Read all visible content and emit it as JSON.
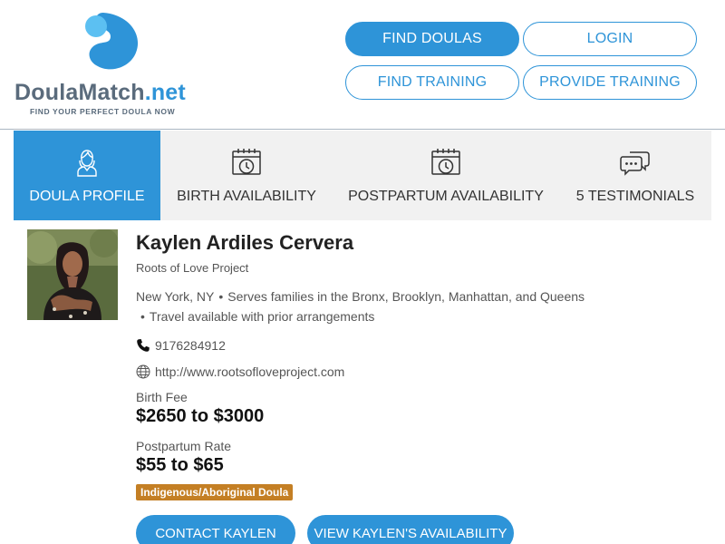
{
  "brand": {
    "name_main": "DoulaMatch",
    "name_suffix": ".net",
    "tagline": "FIND YOUR PERFECT DOULA NOW",
    "accent_color": "#2e94d8",
    "logo_icon": "droplet-logo-icon"
  },
  "nav": {
    "find_doulas": "FIND DOULAS",
    "login": "LOGIN",
    "find_training": "FIND TRAINING",
    "provide_training": "PROVIDE TRAINING"
  },
  "tabs": [
    {
      "label": "DOULA PROFILE",
      "icon": "person-icon",
      "active": true
    },
    {
      "label": "BIRTH AVAILABILITY",
      "icon": "calendar-clock-icon",
      "active": false
    },
    {
      "label": "POSTPARTUM AVAILABILITY",
      "icon": "calendar-clock-icon",
      "active": false
    },
    {
      "label": "5 TESTIMONIALS",
      "icon": "chat-bubbles-icon",
      "active": false
    }
  ],
  "profile": {
    "name": "Kaylen Ardiles Cervera",
    "agency": "Roots of Love Project",
    "location": "New York, NY",
    "service_area": "Serves families in the Bronx, Brooklyn, Manhattan, and Queens",
    "travel": "Travel available with prior arrangements",
    "phone": "9176284912",
    "website": "http://www.rootsofloveproject.com",
    "birth_fee_label": "Birth Fee",
    "birth_fee": "$2650 to $3000",
    "postpartum_label": "Postpartum Rate",
    "postpartum_rate": "$55 to $65",
    "badge": "Indigenous/Aboriginal Doula",
    "badge_color": "#c47f24"
  },
  "actions": {
    "contact": "CONTACT KAYLEN",
    "availability": "VIEW KAYLEN'S AVAILABILITY"
  }
}
